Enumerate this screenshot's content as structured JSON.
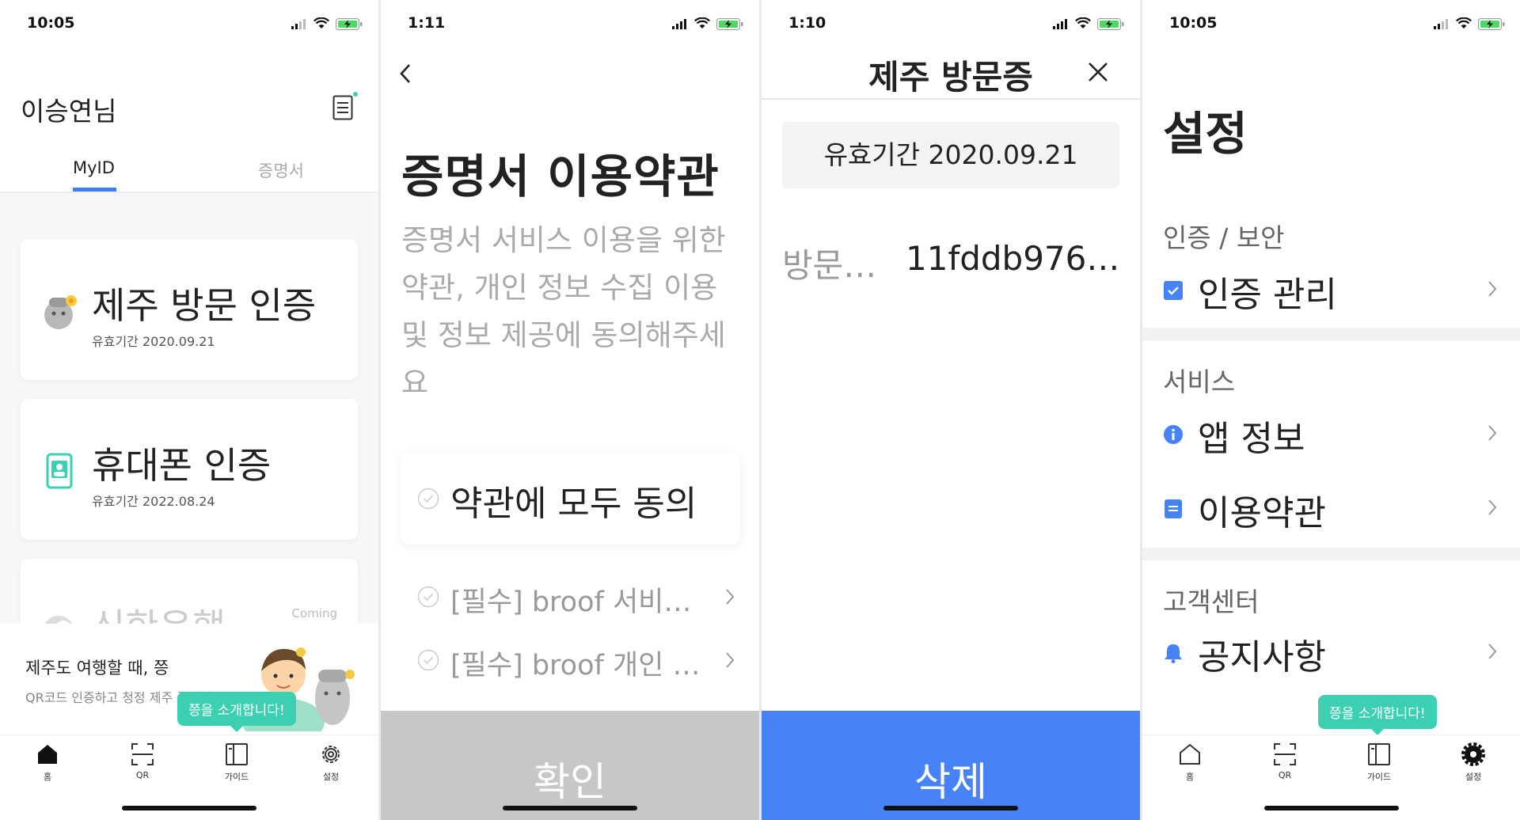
{
  "screen1": {
    "time": "10:05",
    "title": "이승연님",
    "tabs": [
      "MyID",
      "증명서"
    ],
    "cards": [
      {
        "title": "제주 방문 인증",
        "sub": "유효기간 2020.09.21"
      },
      {
        "title": "휴대폰 인증",
        "sub": "유효기간 2022.08.24"
      },
      {
        "title": "신한은행 …",
        "badge": "Coming"
      }
    ],
    "banner": {
      "title": "제주도 여행할 때, 쯩",
      "sub": "QR코드 인증하고 청정 제주 즐기기",
      "bubble": "쯩을 소개합니다!"
    },
    "tabbar": [
      "홈",
      "QR",
      "가이드",
      "설정"
    ]
  },
  "screen2": {
    "time": "1:11",
    "heading": "증명서 이용약관",
    "description": "증명서 서비스 이용을 위한 약관, 개인 정보 수집 이용 및 정보 제공에 동의해주세요",
    "agree_all": "약관에 모두 동의",
    "terms": [
      "[필수] broof 서비…",
      "[필수] broof 개인 …"
    ],
    "confirm": "확인"
  },
  "screen3": {
    "time": "1:10",
    "title": "제주 방문증",
    "valid": "유효기간 2020.09.21",
    "visit_key": "방문…",
    "visit_value": "11fddb976…",
    "delete": "삭제"
  },
  "screen4": {
    "time": "10:05",
    "heading": "설정",
    "sections": [
      {
        "label": "인증 / 보안",
        "items": [
          "인증 관리"
        ]
      },
      {
        "label": "서비스",
        "items": [
          "앱 정보",
          "이용약관"
        ]
      },
      {
        "label": "고객센터",
        "items": [
          "공지사항"
        ]
      }
    ],
    "bubble": "쯩을 소개합니다!",
    "tabbar": [
      "홈",
      "QR",
      "가이드",
      "설정"
    ]
  },
  "colors": {
    "accent": "#3d7df5",
    "mint": "#3ccfb2",
    "button_disabled": "#c7c7c7",
    "button_primary": "#4783f6"
  }
}
